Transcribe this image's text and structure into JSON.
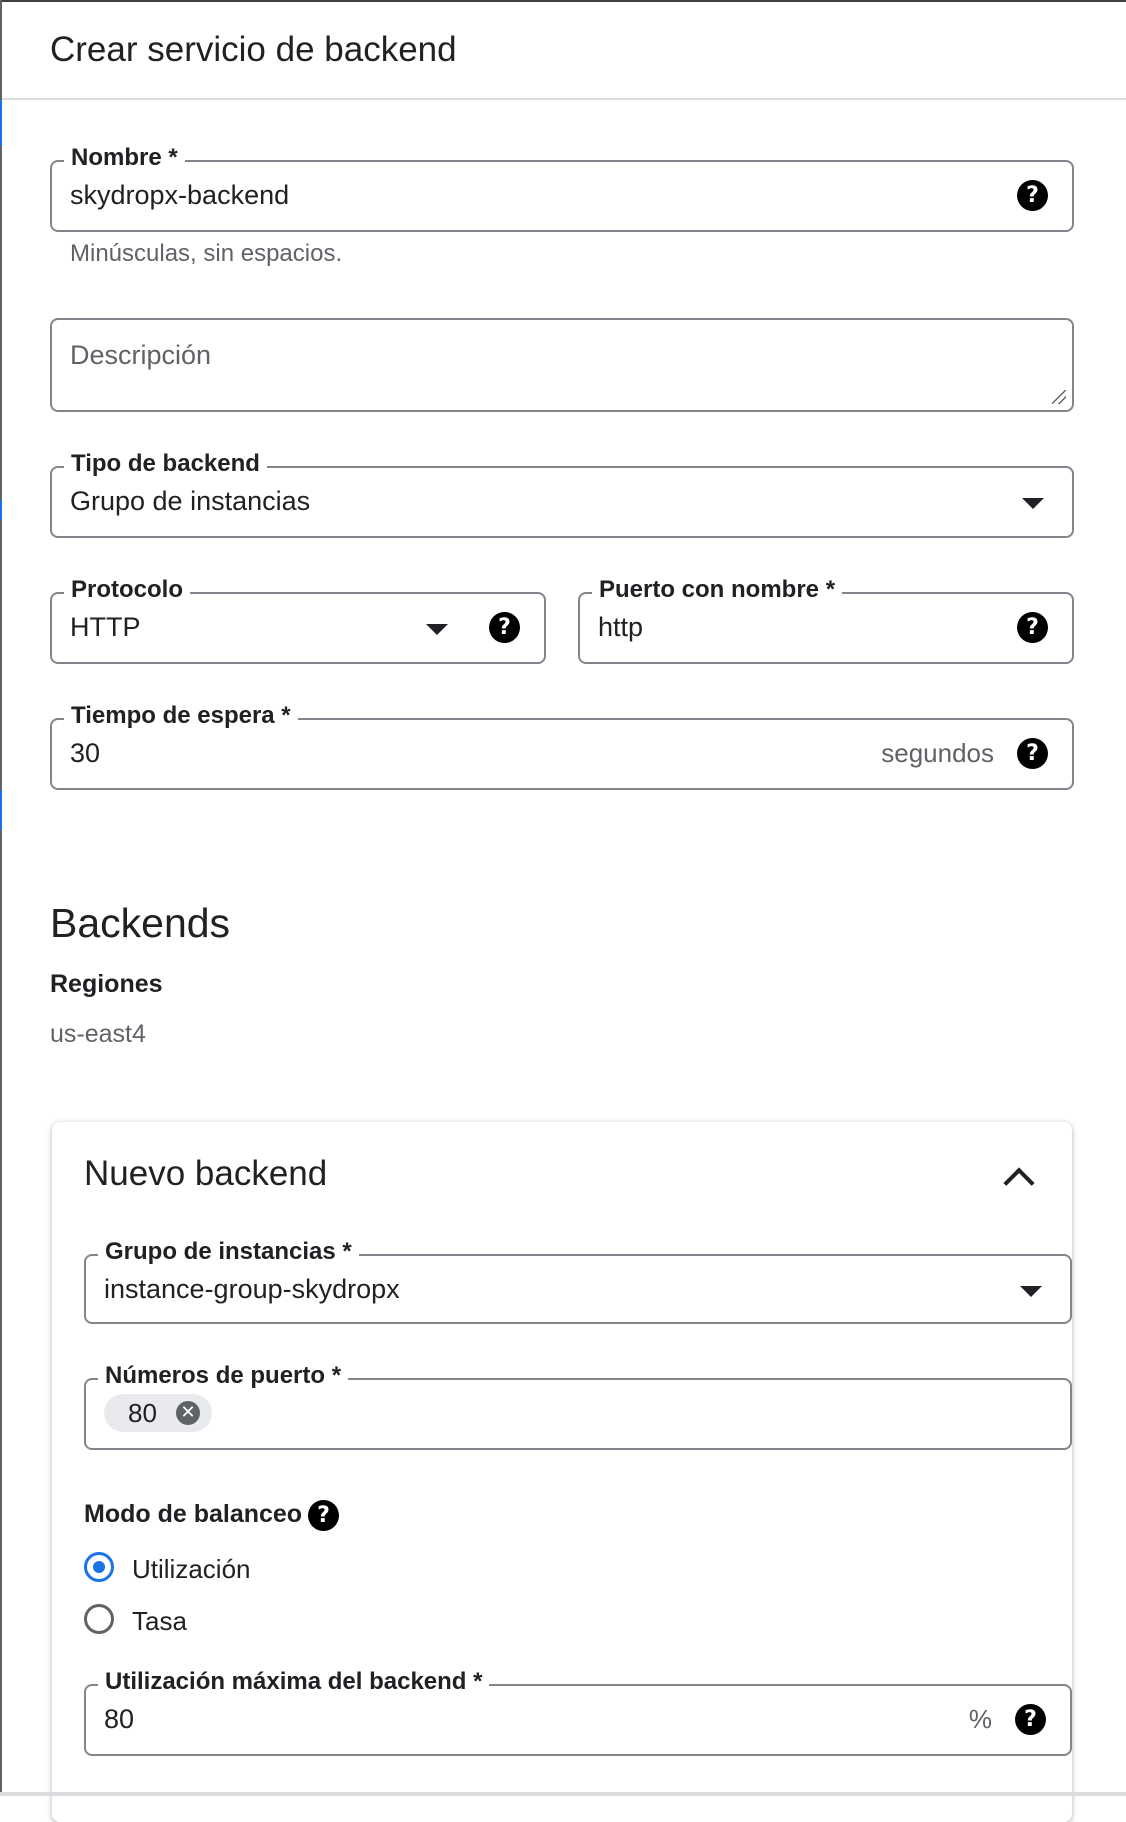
{
  "header": {
    "title": "Crear servicio de backend"
  },
  "form": {
    "name": {
      "label": "Nombre  *",
      "value": "skydropx-backend",
      "hint": "Minúsculas, sin espacios."
    },
    "description": {
      "placeholder": "Descripción",
      "value": ""
    },
    "backend_type": {
      "label": "Tipo de backend",
      "value": "Grupo de instancias"
    },
    "protocol": {
      "label": "Protocolo",
      "value": "HTTP"
    },
    "named_port": {
      "label": "Puerto con nombre *",
      "value": "http"
    },
    "timeout": {
      "label": "Tiempo de espera *",
      "value": "30",
      "unit": "segundos"
    }
  },
  "backends": {
    "title": "Backends",
    "regions_label": "Regiones",
    "regions_value": "us-east4",
    "new_backend": {
      "title": "Nuevo backend",
      "instance_group": {
        "label": "Grupo de instancias *",
        "value": "instance-group-skydropx"
      },
      "port_numbers": {
        "label": "Números de puerto *",
        "chips": [
          "80"
        ]
      },
      "balancing_mode": {
        "label": "Modo de balanceo",
        "options": [
          {
            "label": "Utilización",
            "selected": true
          },
          {
            "label": "Tasa",
            "selected": false
          }
        ]
      },
      "max_utilization": {
        "label": "Utilización máxima del backend *",
        "value": "80",
        "unit": "%"
      }
    }
  },
  "icons": {
    "help": "help-circle-icon",
    "dropdown": "arrow-drop-down-icon",
    "collapse": "chevron-up-icon",
    "chip_remove": "cancel-icon"
  },
  "colors": {
    "accent": "#1a73e8",
    "border": "#80868b",
    "secondary_text": "#5f6368"
  }
}
